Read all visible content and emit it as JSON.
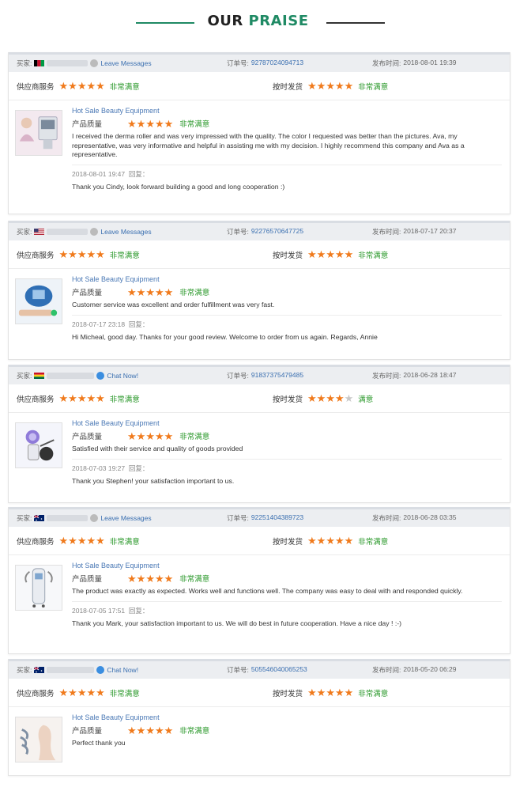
{
  "header": {
    "title_part1": "OUR",
    "title_part2": "PRAISE"
  },
  "labels": {
    "buyer": "买家:",
    "order": "订单号:",
    "published": "发布时间:",
    "supplier_service": "供应商服务",
    "on_time": "按时发货",
    "product_quality": "产品质量",
    "reply": "回复："
  },
  "colors": {
    "accent_green": "#1f8a64",
    "star_orange": "#f07a1c",
    "link_blue": "#3a6fb0",
    "satisfied_green": "#2e9a2e"
  },
  "reviews": [
    {
      "flag": "flag-afghanistan",
      "contact": "Leave Messages",
      "order_no": "92787024094713",
      "date": "2018-08-01 19:39",
      "supplier_stars": 5,
      "supplier_text": "非常满意",
      "shipping_stars": 5,
      "shipping_text": "非常满意",
      "product": "Hot Sale Beauty Equipment",
      "quality_stars": 5,
      "quality_text": "非常满意",
      "comment": "I received the derma roller and was very impressed with the quality. The color I requested was better than the pictures. Ava, my representative, was very informative and helpful in assisting me with my decision. I highly recommend this company and Ava as a representative.",
      "reply_date": "2018-08-01 19:47",
      "reply": "Thank you Cindy, look forward building a good and long cooperation :)"
    },
    {
      "flag": "flag-usa",
      "contact": "Leave Messages",
      "order_no": "92276570647725",
      "date": "2018-07-17 20:37",
      "supplier_stars": 5,
      "supplier_text": "非常满意",
      "shipping_stars": 5,
      "shipping_text": "非常满意",
      "product": "Hot Sale Beauty Equipment",
      "quality_stars": 5,
      "quality_text": "非常满意",
      "comment": "Customer service was excellent and order fulfillment was very fast.",
      "reply_date": "2018-07-17 23:18",
      "reply": "Hi Micheal, good day. Thanks for your good review. Welcome to order from us again. Regards, Annie"
    },
    {
      "flag": "flag-ghana",
      "contact": "Chat Now!",
      "order_no": "91837375479485",
      "date": "2018-06-28 18:47",
      "supplier_stars": 5,
      "supplier_text": "非常满意",
      "shipping_stars": 4,
      "shipping_text": "满意",
      "product": "Hot Sale Beauty Equipment",
      "quality_stars": 5,
      "quality_text": "非常满意",
      "comment": "Satisfied with their service and quality of goods provided",
      "reply_date": "2018-07-03 19:27",
      "reply": "Thank you Stephen! your satisfaction important to us."
    },
    {
      "flag": "flag-australia",
      "contact": "Leave Messages",
      "order_no": "92251404389723",
      "date": "2018-06-28 03:35",
      "supplier_stars": 5,
      "supplier_text": "非常满意",
      "shipping_stars": 5,
      "shipping_text": "非常满意",
      "product": "Hot Sale Beauty Equipment",
      "quality_stars": 5,
      "quality_text": "非常满意",
      "comment": "The product was exactly as expected. Works well and functions well. The company was easy to deal with and responded quickly.",
      "reply_date": "2018-07-05 17:51",
      "reply": "Thank you Mark, your satisfaction important to us. We will do best in future cooperation. Have a nice day ! :-)"
    },
    {
      "flag": "flag-australia",
      "contact": "Chat Now!",
      "order_no": "505546040065253",
      "date": "2018-05-20 06:29",
      "supplier_stars": 5,
      "supplier_text": "非常满意",
      "shipping_stars": 5,
      "shipping_text": "非常满意",
      "product": "Hot Sale Beauty Equipment",
      "quality_stars": 5,
      "quality_text": "非常满意",
      "comment": "Perfect thank you",
      "reply_date": "",
      "reply": ""
    }
  ]
}
